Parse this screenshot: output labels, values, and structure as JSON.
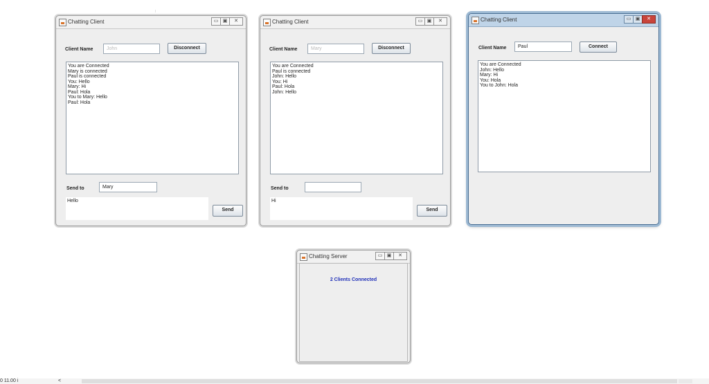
{
  "client_john": {
    "title": "Chatting Client",
    "client_name_label": "Client Name",
    "name_value": "John",
    "connect_button": "Disconnect",
    "log": [
      "You are Connected",
      "Mary is connected",
      "Paul is connected",
      "You: Hello",
      "Mary: Hi",
      "Paul: Hola",
      "You to Mary: Hello",
      "Paul: Hola"
    ],
    "send_to_label": "Send to",
    "send_to_value": "Mary",
    "message_value": "Hello",
    "send_button": "Send"
  },
  "client_mary": {
    "title": "Chatting Client",
    "client_name_label": "Client Name",
    "name_value": "Mary",
    "connect_button": "Disconnect",
    "log": [
      "You are Connected",
      "Paul is connected",
      "John: Hello",
      "You: Hi",
      "Paul: Hola",
      "John: Hello"
    ],
    "send_to_label": "Send to",
    "send_to_value": "",
    "message_value": "Hi",
    "send_button": "Send"
  },
  "client_paul": {
    "title": "Chatting Client",
    "client_name_label": "Client Name",
    "name_value": "Paul",
    "connect_button": "Connect",
    "log": [
      "You are Connected",
      "John: Hello",
      "Mary: Hi",
      "You: Hola",
      "You to John: Hola"
    ]
  },
  "server": {
    "title": "Chatting Server",
    "status": "2 Clients Connected"
  },
  "taskbar": {
    "text": "0    11.00 i",
    "arrow": "<"
  },
  "icons": {
    "window_app": "java-app-icon",
    "minimize": "minimize-icon",
    "maximize": "maximize-icon",
    "close": "close-icon"
  },
  "colors": {
    "status_text": "#1f2fb8",
    "active_close": "#c9443b"
  }
}
